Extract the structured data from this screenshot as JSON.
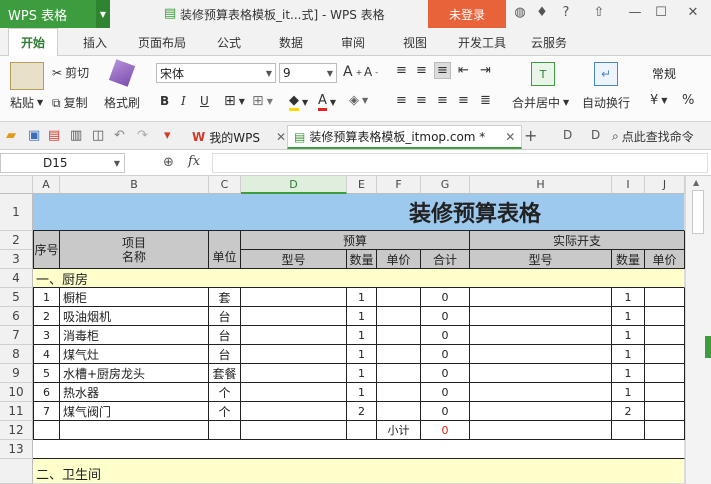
{
  "title_bar": {
    "app_button": "WPS 表格",
    "window_title": "装修预算表格模板_it...式] - WPS 表格",
    "login": "未登录"
  },
  "tabs": [
    "开始",
    "插入",
    "页面布局",
    "公式",
    "数据",
    "审阅",
    "视图",
    "开发工具",
    "云服务"
  ],
  "ribbon": {
    "paste": "粘贴",
    "cut": "剪切",
    "copy": "复制",
    "format_painter": "格式刷",
    "font_name": "宋体",
    "font_size": "9",
    "merge_center": "合并居中",
    "wrap_text": "自动换行",
    "number_format": "常规",
    "bold": "B",
    "italic": "I",
    "underline": "U"
  },
  "doc_tabs": {
    "tab1": "我的WPS",
    "tab2": "装修预算表格模板_itmop.com *",
    "search": "点此查找命令"
  },
  "formula_bar": {
    "cell_ref": "D15",
    "fx": "fx"
  },
  "columns": [
    "A",
    "B",
    "C",
    "D",
    "E",
    "F",
    "G",
    "H",
    "I",
    "J"
  ],
  "rows": [
    "1",
    "2",
    "3",
    "4",
    "5",
    "6",
    "7",
    "8",
    "9",
    "10",
    "11",
    "12",
    "13"
  ],
  "sheet": {
    "title": "装修预算表格",
    "hdr_seq": "序号",
    "hdr_item": "项目名称",
    "hdr_unit": "单位",
    "hdr_budget": "预算",
    "hdr_actual": "实际开支",
    "hdr_model": "型号",
    "hdr_qty": "数量",
    "hdr_price": "单价",
    "hdr_total": "合计",
    "hdr_model2": "型号",
    "hdr_qty2": "数量",
    "hdr_price2": "单价",
    "section1": "一、厨房",
    "items": [
      {
        "n": "1",
        "name": "橱柜",
        "unit": "套",
        "qty": "1",
        "total": "0",
        "qty2": "1"
      },
      {
        "n": "2",
        "name": "吸油烟机",
        "unit": "台",
        "qty": "1",
        "total": "0",
        "qty2": "1"
      },
      {
        "n": "3",
        "name": "消毒柜",
        "unit": "台",
        "qty": "1",
        "total": "0",
        "qty2": "1"
      },
      {
        "n": "4",
        "name": "煤气灶",
        "unit": "台",
        "qty": "1",
        "total": "0",
        "qty2": "1"
      },
      {
        "n": "5",
        "name": "水槽+厨房龙头",
        "unit": "套餐",
        "qty": "1",
        "total": "0",
        "qty2": "1"
      },
      {
        "n": "6",
        "name": "热水器",
        "unit": "个",
        "qty": "1",
        "total": "0",
        "qty2": "1"
      },
      {
        "n": "7",
        "name": "煤气阀门",
        "unit": "个",
        "qty": "2",
        "total": "0",
        "qty2": "2"
      }
    ],
    "subtotal_label": "小计",
    "subtotal_value": "0",
    "section2": "二、卫生间"
  }
}
